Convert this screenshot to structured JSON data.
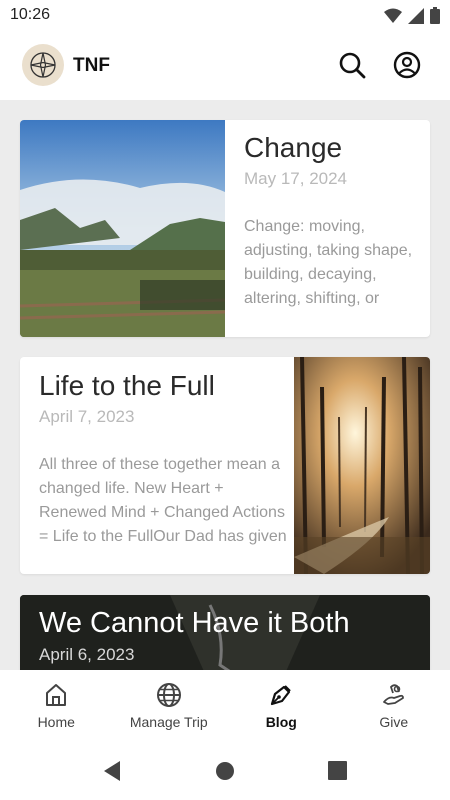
{
  "status_bar": {
    "time": "10:26"
  },
  "app_bar": {
    "title": "TNF"
  },
  "posts": [
    {
      "title": "Change",
      "date": "May 17, 2024",
      "excerpt": "Change: moving, adjusting, taking shape, building, decaying, altering, shifting, or morphing from one"
    },
    {
      "title": "Life to the Full",
      "date": "April 7, 2023",
      "excerpt": "All three of these together mean a changed life. New Heart + Renewed Mind + Changed Actions = Life to the FullOur Dad has given us a new heart (EZ"
    },
    {
      "title": "We Cannot Have it Both",
      "date": "April 6, 2023"
    }
  ],
  "bottom_nav": [
    {
      "label": "Home"
    },
    {
      "label": "Manage Trip"
    },
    {
      "label": "Blog"
    },
    {
      "label": "Give"
    }
  ]
}
